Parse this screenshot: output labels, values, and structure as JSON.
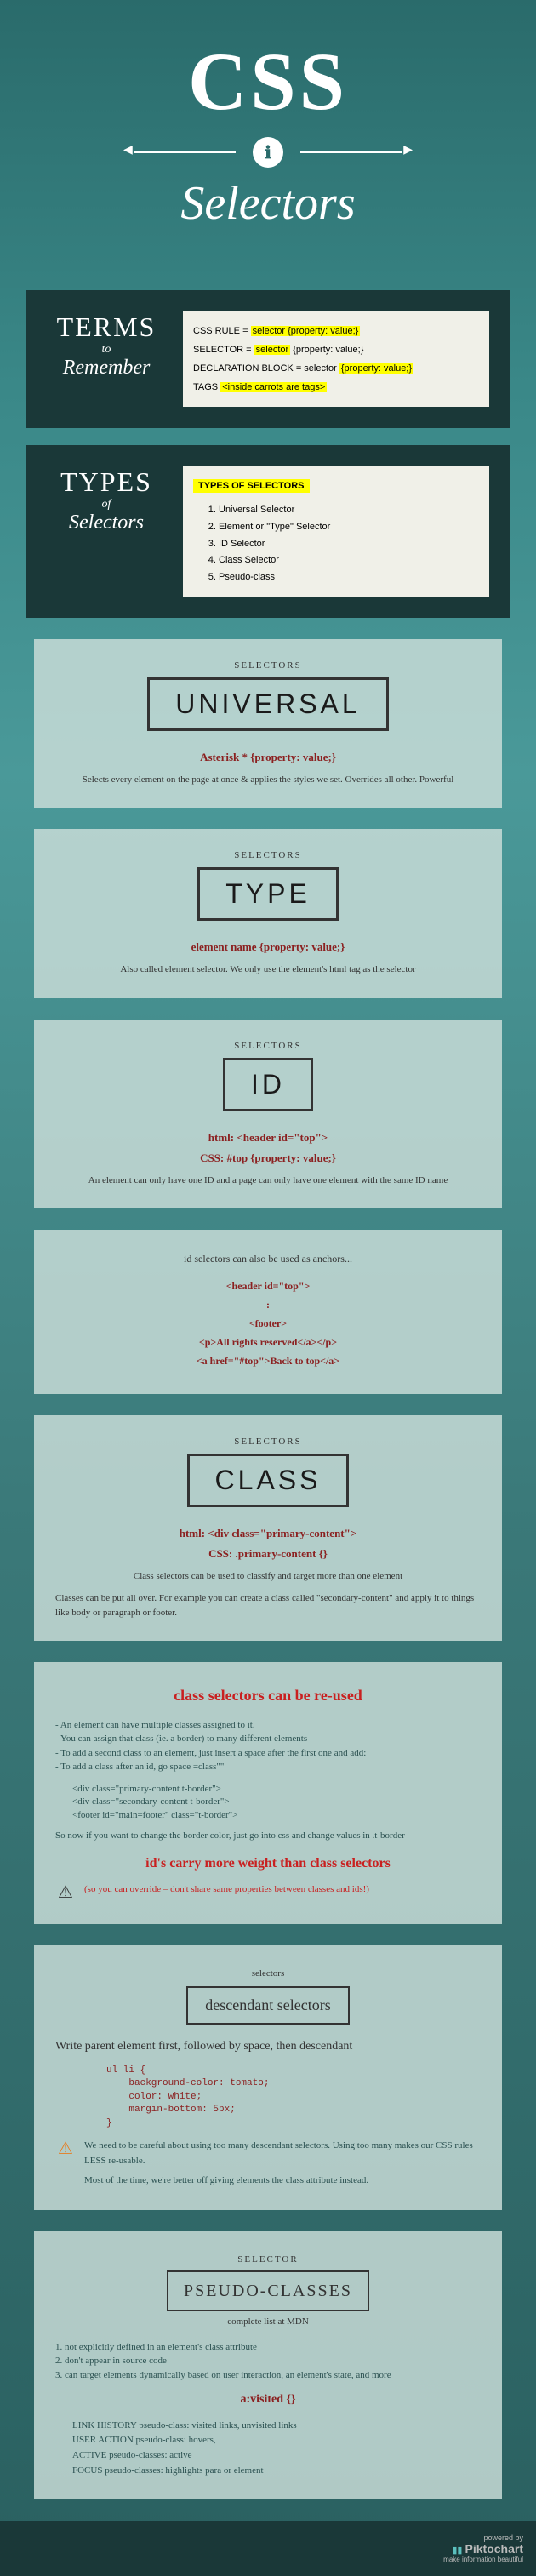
{
  "hero": {
    "title": "CSS",
    "subtitle": "Selectors",
    "icon": "ℹ"
  },
  "terms": {
    "heading_big": "TERMS",
    "heading_small": "to",
    "heading_med": "Remember",
    "line1_pre": "CSS RULE = ",
    "line1_hl": "selector {property: value;}",
    "line2_pre": "SELECTOR = ",
    "line2_hl": "selector",
    "line2_post": " {property: value;}",
    "line3_pre": "DECLARATION BLOCK =  selector ",
    "line3_hl": "{property: value;}",
    "line4_pre": "TAGS ",
    "line4_hl": "<inside carrots are tags>"
  },
  "types": {
    "heading_big": "TYPES",
    "heading_small": "of",
    "heading_med": "Selectors",
    "title": "TYPES OF SELECTORS",
    "items": [
      "Universal Selector",
      "Element or \"Type\" Selector",
      "ID Selector",
      "Class Selector",
      "Pseudo-class"
    ]
  },
  "universal": {
    "label": "SELECTORS",
    "title": "UNIVERSAL",
    "syntax": "Asterisk   * {property: value;}",
    "desc": "Selects every element on the page at once & applies the styles we set. Overrides all other. Powerful"
  },
  "type": {
    "label": "SELECTORS",
    "title": "TYPE",
    "syntax": "element name  {property: value;}",
    "desc": "Also called element selector.  We only use the element's html tag as the selector"
  },
  "id": {
    "label": "SELECTORS",
    "title": "ID",
    "syntax1": "html:   <header id=\"top\">",
    "syntax2": "CSS:    #top  {property: value;}",
    "desc": "An element can only have one ID and a page can only have one element with the same ID name"
  },
  "anchor": {
    "heading": "id selectors can also be used as anchors...",
    "code1": "<header id=\"top\">",
    "code2": ":",
    "code3": "<footer>",
    "code4": "<p>All rights reserved</a></p>",
    "code5": "<a href=\"#top\">Back to top</a>"
  },
  "class": {
    "label": "SELECTORS",
    "title": "CLASS",
    "syntax1": "html:   <div class=\"primary-content\">",
    "syntax2": "CSS:   .primary-content {}",
    "desc1": "Class selectors can be used to classify and target more than one element",
    "desc2": "Classes can be put all over. For example you can create a class called \"secondary-content\" and apply it to things like body or paragraph or footer."
  },
  "reuse": {
    "heading": "class selectors can be re-used",
    "b1": "- An element can have multiple classes assigned to it.",
    "b2": "- You can assign that class (ie. a border) to many different elements",
    "b3": "- To add a second class to an element, just insert a space after the first one and add:",
    "b4": "- To add a class after an id, go space =class\"\"",
    "c1": "<div class=\"primary-content t-border\">",
    "c2": "<div class=\"secondary-content t-border\">",
    "c3": "<footer id=\"main=footer\" class=\"t-border\">",
    "note": "So now if you want to change the border color, just go into css and change values in .t-border",
    "warn_title": "id's carry more weight than class selectors",
    "warn_text": "(so you can override – don't share same properties between classes and ids!)",
    "warn_icon": "⚠"
  },
  "desc_sel": {
    "label": "selectors",
    "title": "descendant selectors",
    "heading": "Write parent element first, followed by space, then descendant",
    "code": "ul li {\n    background-color: tomato;\n    color: white;\n    margin-bottom: 5px;\n}",
    "warn_icon": "⚠",
    "warn1": "We need to be careful about using too many descendant selectors. Using too many makes our CSS rules LESS re-usable.",
    "warn2": "Most of the time, we're better off giving elements the class attribute instead."
  },
  "pseudo": {
    "label": "SELECTOR",
    "title": "PSEUDO-CLASSES",
    "sub": "complete list at MDN",
    "n1": "1. not explicitly defined in an element's class attribute",
    "n2": "2. don't appear in source code",
    "n3": "3. can target elements dynamically based on user interaction, an element's state,  and more",
    "syntax": "a:visited {}",
    "f1": "LINK HISTORY pseudo-class: visited links, unvisited links",
    "f2": "USER ACTION pseudo-class:  hovers,",
    "f3": "ACTIVE pseudo-classes: active",
    "f4": "FOCUS pseudo-classes: highlights para or element"
  },
  "footer": {
    "pre": "powered by",
    "brand": "Piktochart",
    "tag": "make information beautiful"
  }
}
